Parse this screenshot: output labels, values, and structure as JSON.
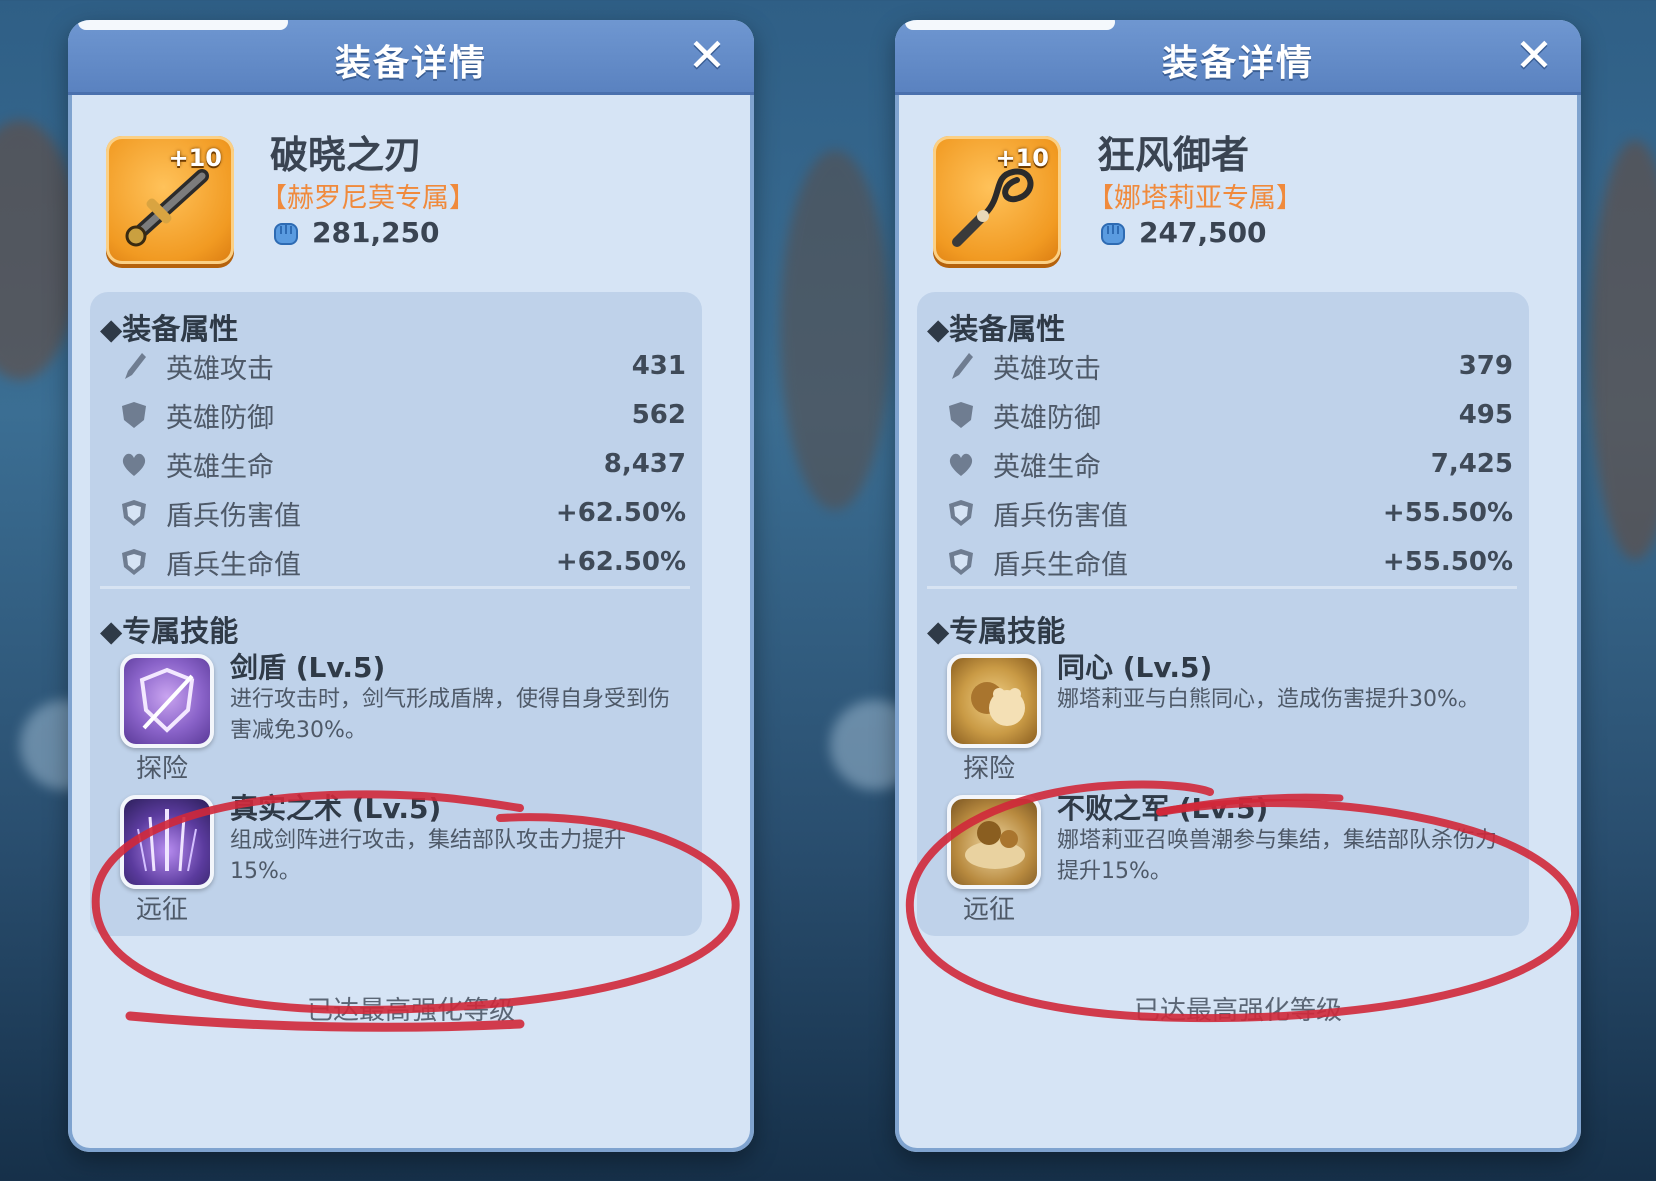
{
  "panels": [
    {
      "title": "装备详情",
      "close_icon": "close-icon",
      "item": {
        "level_badge": "+10",
        "name": "破晓之刃",
        "exclusive": "【赫罗尼莫专属】",
        "power": "281,250",
        "icon": "sword-icon"
      },
      "attributes_title": "◆装备属性",
      "attributes": [
        {
          "icon": "sword-attack-icon",
          "label": "英雄攻击",
          "value": "431"
        },
        {
          "icon": "shield-defense-icon",
          "label": "英雄防御",
          "value": "562"
        },
        {
          "icon": "heart-icon",
          "label": "英雄生命",
          "value": "8,437"
        },
        {
          "icon": "shield-troop-icon",
          "label": "盾兵伤害值",
          "value": "+62.50%"
        },
        {
          "icon": "shield-troop-icon",
          "label": "盾兵生命值",
          "value": "+62.50%"
        }
      ],
      "skills_title": "◆专属技能",
      "skills": [
        {
          "name": "剑盾 (Lv.5)",
          "desc": "进行攻击时，剑气形成盾牌，使得自身受到伤害减免30%。",
          "tag": "探险",
          "color": "#8a63c9"
        },
        {
          "name": "真实之术 (Lv.5)",
          "desc": "组成剑阵进行攻击，集结部队攻击力提升15%。",
          "tag": "远征",
          "color": "#5b3b9e"
        }
      ],
      "footer": "已达最高强化等级"
    },
    {
      "title": "装备详情",
      "close_icon": "close-icon",
      "item": {
        "level_badge": "+10",
        "name": "狂风御者",
        "exclusive": "【娜塔莉亚专属】",
        "power": "247,500",
        "icon": "whip-icon"
      },
      "attributes_title": "◆装备属性",
      "attributes": [
        {
          "icon": "sword-attack-icon",
          "label": "英雄攻击",
          "value": "379"
        },
        {
          "icon": "shield-defense-icon",
          "label": "英雄防御",
          "value": "495"
        },
        {
          "icon": "heart-icon",
          "label": "英雄生命",
          "value": "7,425"
        },
        {
          "icon": "shield-troop-icon",
          "label": "盾兵伤害值",
          "value": "+55.50%"
        },
        {
          "icon": "shield-troop-icon",
          "label": "盾兵生命值",
          "value": "+55.50%"
        }
      ],
      "skills_title": "◆专属技能",
      "skills": [
        {
          "name": "同心 (Lv.5)",
          "desc": "娜塔莉亚与白熊同心，造成伤害提升30%。",
          "tag": "探险",
          "color": "#c99a45"
        },
        {
          "name": "不败之军 (Lv.5)",
          "desc": "娜塔莉亚召唤兽潮参与集结，集结部队杀伤力提升15%。",
          "tag": "远征",
          "color": "#b88a3f"
        }
      ],
      "footer": "已达最高强化等级"
    }
  ],
  "colors": {
    "exclusive": "#f08a3c",
    "header": "#5a82c0",
    "annotation": "#d0283a"
  }
}
